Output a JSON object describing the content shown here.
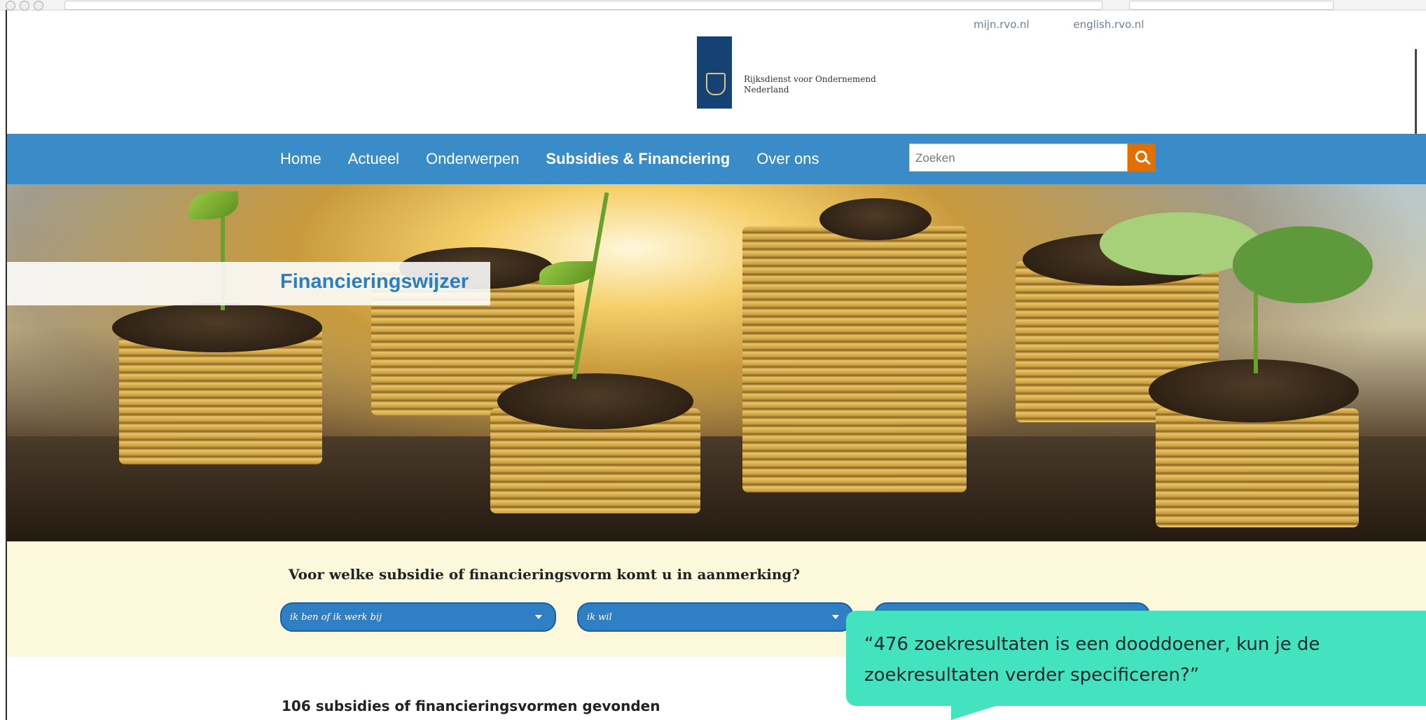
{
  "header": {
    "top_links": [
      "mijn.rvo.nl",
      "english.rvo.nl"
    ],
    "logo_text_line1": "Rijksdienst voor Ondernemend",
    "logo_text_line2": "Nederland"
  },
  "nav": {
    "items": [
      {
        "label": "Home"
      },
      {
        "label": "Actueel"
      },
      {
        "label": "Onderwerpen"
      },
      {
        "label": "Subsidies & Financiering"
      },
      {
        "label": "Over ons"
      }
    ],
    "search_placeholder": "Zoeken"
  },
  "hero": {
    "title": "Financieringswijzer"
  },
  "filter": {
    "question": "Voor welke subsidie of financieringsvorm komt u in aanmerking?",
    "select1_value": "ik ben of ik werk bij",
    "select2_value": "ik wil",
    "select3_value": ""
  },
  "results": {
    "count_text": "106 subsidies of financieringsvormen gevonden"
  },
  "annotation": {
    "quote": "“476 zoekresultaten is een dooddoener, kun je de zoekresultaten verder specificeren?”"
  },
  "colors": {
    "nav_blue": "#3a8cc9",
    "logo_blue": "#154273",
    "search_orange": "#e17000",
    "filter_bg": "#fbf8dc",
    "bubble": "#43e3c0"
  }
}
